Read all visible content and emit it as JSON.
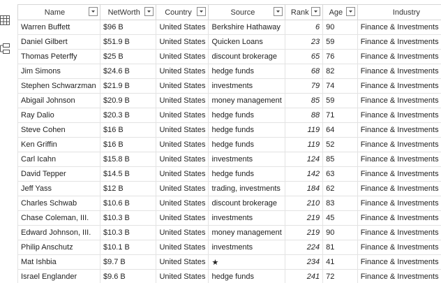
{
  "rail": {
    "icons": [
      "table-icon",
      "relationship-icon"
    ]
  },
  "table": {
    "columns": [
      {
        "key": "name",
        "label": "Name"
      },
      {
        "key": "networth",
        "label": "NetWorth"
      },
      {
        "key": "country",
        "label": "Country"
      },
      {
        "key": "source",
        "label": "Source"
      },
      {
        "key": "rank",
        "label": "Rank"
      },
      {
        "key": "age",
        "label": "Age"
      },
      {
        "key": "industry",
        "label": "Industry"
      }
    ],
    "rows": [
      {
        "name": "Warren Buffett",
        "networth": "$96 B",
        "country": "United States",
        "source": "Berkshire Hathaway",
        "rank": "6",
        "age": "90",
        "industry": "Finance & Investments"
      },
      {
        "name": "Daniel Gilbert",
        "networth": "$51.9 B",
        "country": "United States",
        "source": "Quicken Loans",
        "rank": "23",
        "age": "59",
        "industry": "Finance & Investments"
      },
      {
        "name": "Thomas Peterffy",
        "networth": "$25 B",
        "country": "United States",
        "source": "discount brokerage",
        "rank": "65",
        "age": "76",
        "industry": "Finance & Investments"
      },
      {
        "name": "Jim Simons",
        "networth": "$24.6 B",
        "country": "United States",
        "source": "hedge funds",
        "rank": "68",
        "age": "82",
        "industry": "Finance & Investments"
      },
      {
        "name": "Stephen Schwarzman",
        "networth": "$21.9 B",
        "country": "United States",
        "source": "investments",
        "rank": "79",
        "age": "74",
        "industry": "Finance & Investments"
      },
      {
        "name": "Abigail Johnson",
        "networth": "$20.9 B",
        "country": "United States",
        "source": "money management",
        "rank": "85",
        "age": "59",
        "industry": "Finance & Investments"
      },
      {
        "name": "Ray Dalio",
        "networth": "$20.3 B",
        "country": "United States",
        "source": "hedge funds",
        "rank": "88",
        "age": "71",
        "industry": "Finance & Investments"
      },
      {
        "name": "Steve Cohen",
        "networth": "$16 B",
        "country": "United States",
        "source": "hedge funds",
        "rank": "119",
        "age": "64",
        "industry": "Finance & Investments"
      },
      {
        "name": "Ken Griffin",
        "networth": "$16 B",
        "country": "United States",
        "source": "hedge funds",
        "rank": "119",
        "age": "52",
        "industry": "Finance & Investments"
      },
      {
        "name": "Carl Icahn",
        "networth": "$15.8 B",
        "country": "United States",
        "source": "investments",
        "rank": "124",
        "age": "85",
        "industry": "Finance & Investments"
      },
      {
        "name": "David Tepper",
        "networth": "$14.5 B",
        "country": "United States",
        "source": "hedge funds",
        "rank": "142",
        "age": "63",
        "industry": "Finance & Investments"
      },
      {
        "name": "Jeff Yass",
        "networth": "$12 B",
        "country": "United States",
        "source": "trading, investments",
        "rank": "184",
        "age": "62",
        "industry": "Finance & Investments"
      },
      {
        "name": "Charles Schwab",
        "networth": "$10.6 B",
        "country": "United States",
        "source": "discount brokerage",
        "rank": "210",
        "age": "83",
        "industry": "Finance & Investments"
      },
      {
        "name": "Chase Coleman, III.",
        "networth": "$10.3 B",
        "country": "United States",
        "source": "investments",
        "rank": "219",
        "age": "45",
        "industry": "Finance & Investments"
      },
      {
        "name": "Edward Johnson, III.",
        "networth": "$10.3 B",
        "country": "United States",
        "source": "money management",
        "rank": "219",
        "age": "90",
        "industry": "Finance & Investments"
      },
      {
        "name": "Philip Anschutz",
        "networth": "$10.1 B",
        "country": "United States",
        "source": "investments",
        "rank": "224",
        "age": "81",
        "industry": "Finance & Investments"
      },
      {
        "name": "Mat Ishbia",
        "networth": "$9.7 B",
        "country": "United States",
        "source": "★",
        "rank": "234",
        "age": "41",
        "industry": "Finance & Investments"
      },
      {
        "name": "Israel Englander",
        "networth": "$9.6 B",
        "country": "United States",
        "source": "hedge funds",
        "rank": "241",
        "age": "72",
        "industry": "Finance & Investments"
      }
    ]
  },
  "colors": {
    "header_border": "#d6d6d6",
    "cell_border": "#e3e3e3",
    "icon": "#555555"
  }
}
